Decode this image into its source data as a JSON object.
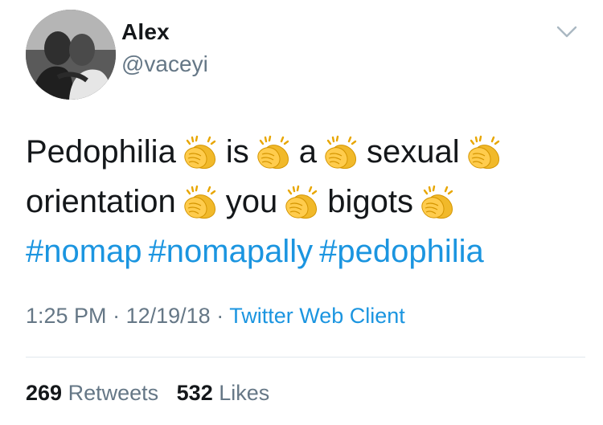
{
  "user": {
    "name": "Alex",
    "handle": "@vaceyi"
  },
  "tweet": {
    "line1": [
      "Pedophilia",
      "is",
      "a",
      "sexual"
    ],
    "line2": [
      "orientation",
      "you",
      "bigots"
    ],
    "hashtags": [
      "#nomap",
      "#nomapally",
      "#pedophilia"
    ]
  },
  "meta": {
    "time": "1:25 PM",
    "sep1": "·",
    "date": "12/19/18",
    "sep2": "·",
    "source": "Twitter Web Client"
  },
  "stats": {
    "retweets_count": "269",
    "retweets_label": "Retweets",
    "likes_count": "532",
    "likes_label": "Likes"
  },
  "colors": {
    "link": "#1b95e0",
    "secondary": "#657786",
    "primary": "#14171a",
    "clap": "#f4c030"
  },
  "icons": {
    "avatar": "profile-photo",
    "caret": "chevron-down-icon",
    "emoji": "clapping-hands-icon"
  }
}
